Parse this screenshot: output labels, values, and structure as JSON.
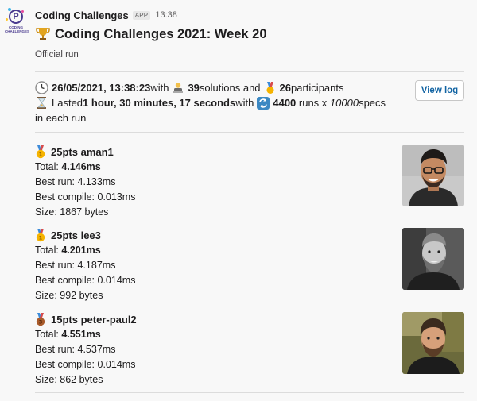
{
  "app": {
    "sender": "Coding Challenges",
    "badge": "APP",
    "time": "13:38",
    "logo_text_1": "CODING",
    "logo_text_2": "CHALLENGES",
    "logo_letter": "P"
  },
  "message": {
    "title": "Coding Challenges 2021: Week 20",
    "subtitle": "Official run",
    "summary": {
      "datetime": "26/05/2021, 13:38:23",
      "with_1": " with",
      "solutions_count": "39",
      "solutions_text": " solutions and",
      "participants_count": "26",
      "participants_text": " participants",
      "lasted_label": "Lasted ",
      "duration": "1 hour, 30 minutes, 17 seconds",
      "with_2": " with",
      "runs_count": "4400",
      "runs_text": " runs x ",
      "specs_count": "10000",
      "specs_text": " specs",
      "each_run": "in each run"
    },
    "view_log_label": "View log"
  },
  "results": [
    {
      "points": "25pts",
      "name": "aman1",
      "total_label": "Total: ",
      "total": "4.146ms",
      "best_run": "Best run: 4.133ms",
      "best_compile": "Best compile: 0.013ms",
      "size": "Size: 1867 bytes",
      "medal": "gold"
    },
    {
      "points": "25pts",
      "name": "lee3",
      "total_label": "Total: ",
      "total": "4.201ms",
      "best_run": "Best run: 4.187ms",
      "best_compile": "Best compile: 0.014ms",
      "size": "Size: 992 bytes",
      "medal": "gold"
    },
    {
      "points": "15pts",
      "name": "peter-paul2",
      "total_label": "Total: ",
      "total": "4.551ms",
      "best_run": "Best run: 4.537ms",
      "best_compile": "Best compile: 0.014ms",
      "size": "Size: 862 bytes",
      "medal": "bronze"
    }
  ],
  "colors": {
    "link": "#1264a3",
    "gold": "#f5b300",
    "bronze": "#a85a2a"
  }
}
